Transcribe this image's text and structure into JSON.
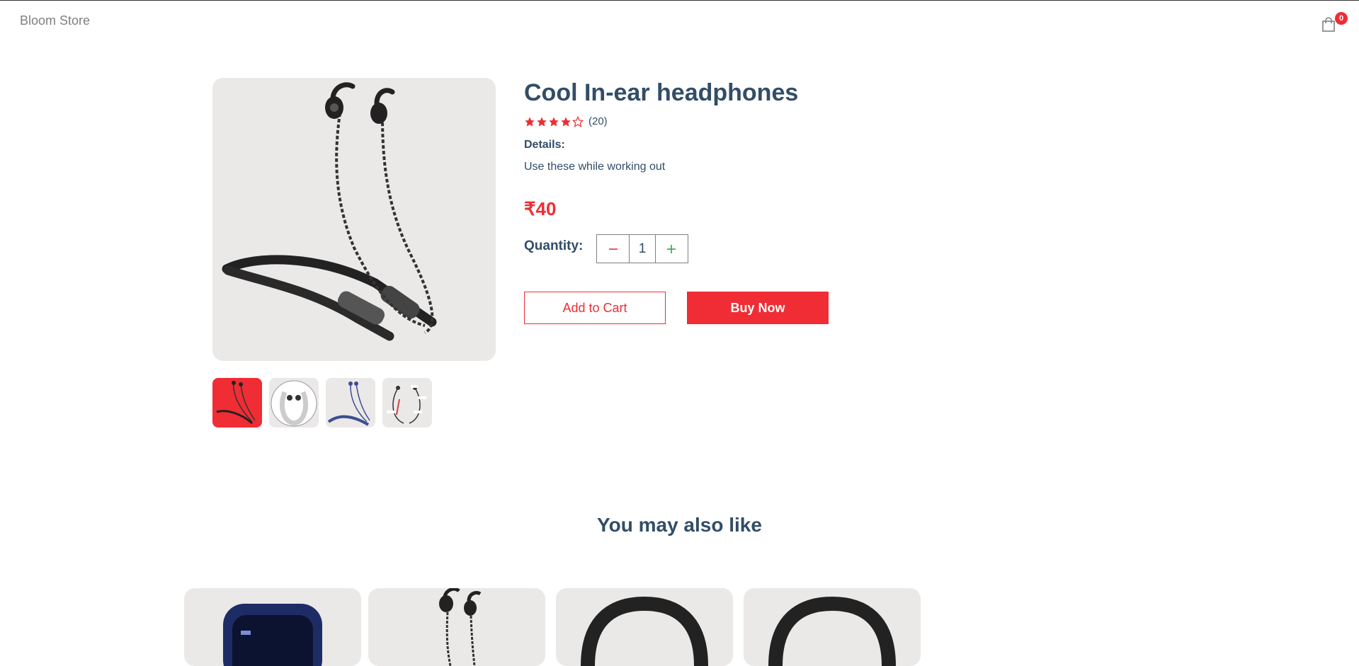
{
  "navbar": {
    "logo": "Bloom Store",
    "cart_count": "0",
    "cart_icon": "shopping-bag-icon"
  },
  "product": {
    "title": "Cool In-ear headphones",
    "rating": 4,
    "rating_max": 5,
    "review_count": "(20)",
    "details_heading": "Details:",
    "details_text": "Use these while working out",
    "price": "₹40",
    "quantity_label": "Quantity:",
    "quantity": "1",
    "add_to_cart_label": "Add to Cart",
    "buy_now_label": "Buy Now"
  },
  "gallery": {
    "selected_index": 0,
    "thumbnail_count": 4
  },
  "related": {
    "heading": "You may also like",
    "card_count": 4
  },
  "colors": {
    "accent": "#f02d34",
    "text": "#324d67",
    "image_bg": "#ebe8e8",
    "plus": "#2ba84a"
  }
}
